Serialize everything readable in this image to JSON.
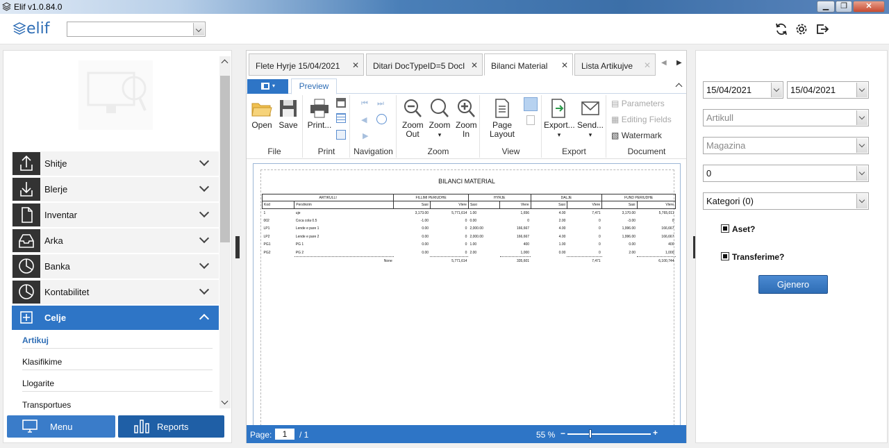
{
  "window": {
    "title": "Elif v1.0.84.0"
  },
  "header": {
    "logo_text": "elif",
    "company_select_value": ""
  },
  "sidebar": {
    "items": [
      {
        "label": "Shitje",
        "icon": "upload-icon"
      },
      {
        "label": "Blerje",
        "icon": "download-icon"
      },
      {
        "label": "Inventar",
        "icon": "file-icon"
      },
      {
        "label": "Arka",
        "icon": "inbox-icon"
      },
      {
        "label": "Banka",
        "icon": "clock-chart-icon"
      },
      {
        "label": "Kontabilitet",
        "icon": "clock-chart-icon"
      },
      {
        "label": "Celje",
        "icon": "plus-box-icon"
      }
    ],
    "subitems": [
      "Artikuj",
      "Klasifikime",
      "Llogarite",
      "Transportues"
    ],
    "bottom_buttons": {
      "menu": "Menu",
      "reports": "Reports"
    }
  },
  "tabs": [
    {
      "label": "Flete Hyrje 15/04/2021"
    },
    {
      "label": "Ditari DocTypeID=5 DocI"
    },
    {
      "label": "Bilanci Material"
    },
    {
      "label": "Lista Artikujve"
    }
  ],
  "ribbon": {
    "preview_tab": "Preview",
    "file": {
      "open": "Open",
      "save": "Save",
      "group": "File"
    },
    "print": {
      "print": "Print...",
      "group": "Print"
    },
    "navigation": {
      "group": "Navigation"
    },
    "zoom": {
      "zoom_out": "Zoom Out",
      "zoom": "Zoom",
      "zoom_in": "Zoom In",
      "group": "Zoom"
    },
    "view": {
      "page_layout": "Page Layout",
      "group": "View"
    },
    "export": {
      "export": "Export...",
      "send": "Send...",
      "group": "Export"
    },
    "document": {
      "parameters": "Parameters",
      "editing_fields": "Editing Fields",
      "watermark": "Watermark",
      "group": "Document"
    }
  },
  "report": {
    "title": "BILANCI MATERIAL",
    "group_headers": [
      "ARTIKULLI",
      "FILLIMI PERIUDHE",
      "HYRJE",
      "DALJE",
      "FUND PERIUDHE"
    ],
    "col_headers": [
      "Kod",
      "Pershkrim",
      "Sasi",
      "Vlere",
      "Sasi",
      "Vlere",
      "Sasi",
      "Vlere",
      "Sasi",
      "Vlere"
    ],
    "rows": [
      [
        "1",
        "uje",
        "3,173.00",
        "5,771,614",
        "1.00",
        "1,656",
        "4.00",
        "7,471",
        "3,170.00",
        "5,765,011"
      ],
      [
        "002",
        "Coca cola 0.5",
        "-1.00",
        "0",
        "0.00",
        "0",
        "2.00",
        "0",
        "-3.00",
        "0"
      ],
      [
        "LP1",
        "Lende e pare 1",
        "0.00",
        "0",
        "2,000.00",
        "166,667",
        "4.00",
        "0",
        "1,996.00",
        "166,667"
      ],
      [
        "LP2",
        "Lende e pare 2",
        "0.00",
        "0",
        "2,000.00",
        "166,667",
        "4.00",
        "0",
        "1,996.00",
        "166,667"
      ],
      [
        "PG1",
        "PG 1",
        "0.00",
        "0",
        "1.00",
        "400",
        "1.00",
        "0",
        "0.00",
        "400"
      ],
      [
        "PG2",
        "PG 2",
        "0.00",
        "0",
        "2.00",
        "1,000",
        "0.00",
        "0",
        "2.00",
        "1,000"
      ]
    ],
    "total_row": [
      "None",
      "5,771,614",
      "335,601",
      "7,471",
      "6,100,744"
    ]
  },
  "statusbar": {
    "page_label": "Page:",
    "page_value": "1",
    "page_total": "/ 1",
    "zoom": "55 %"
  },
  "filters": {
    "date_from": "15/04/2021",
    "date_to": "15/04/2021",
    "artikull": "Artikull",
    "magazina": "Magazina",
    "value_zero": "0",
    "kategori": "Kategori (0)",
    "aset_label": "Aset?",
    "transferime_label": "Transferime?",
    "generate_button": "Gjenero"
  }
}
